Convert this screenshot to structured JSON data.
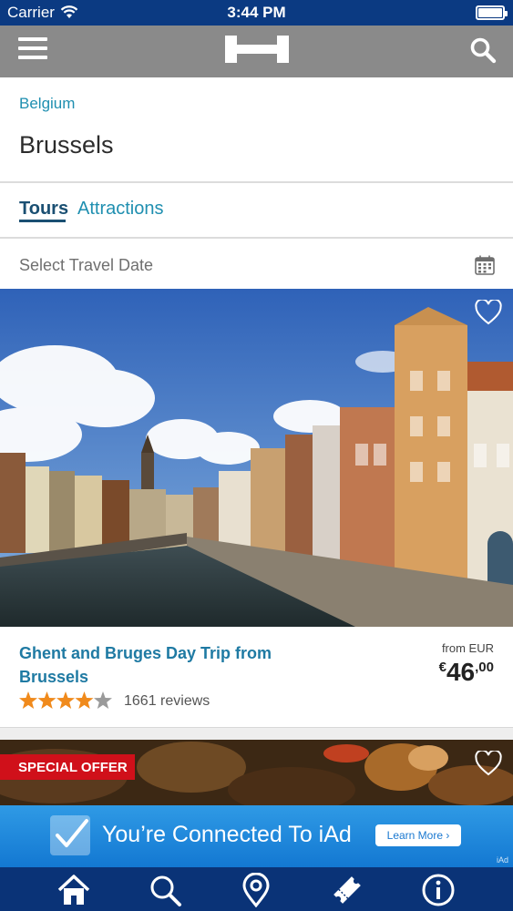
{
  "status_bar": {
    "carrier": "Carrier",
    "time": "3:44 PM"
  },
  "navbar": {
    "menu_icon": "hamburger-menu-icon",
    "logo_icon": "hotels-h-logo-icon",
    "search_icon": "search-icon"
  },
  "breadcrumb": "Belgium",
  "page_title": "Brussels",
  "tabs": [
    {
      "label": "Tours",
      "active": true
    },
    {
      "label": "Attractions",
      "active": false
    }
  ],
  "date_picker": {
    "label": "Select Travel Date",
    "icon": "calendar-icon"
  },
  "tours": [
    {
      "title": "Ghent and Bruges Day Trip from Brussels",
      "price_from_label": "from EUR",
      "price_currency_symbol": "€",
      "price_whole": "46",
      "price_cents": ",00",
      "rating": 4,
      "rating_max": 5,
      "reviews": "1661 reviews"
    },
    {
      "badge": "SPECIAL OFFER"
    }
  ],
  "ad_banner": {
    "text": "You’re Connected To iAd",
    "button_label": "Learn More ›",
    "mark": "iAd"
  },
  "tab_bar": [
    "home-icon",
    "search-icon",
    "map-pin-icon",
    "ticket-icon",
    "info-icon"
  ],
  "colors": {
    "status_bar": "#0b3a82",
    "navbar": "#8a8a8a",
    "link": "#1f8fb0",
    "active_tab": "#1a4f72",
    "star": "#f08a1c",
    "badge": "#d0101a",
    "tab_bar": "#0a3377"
  }
}
